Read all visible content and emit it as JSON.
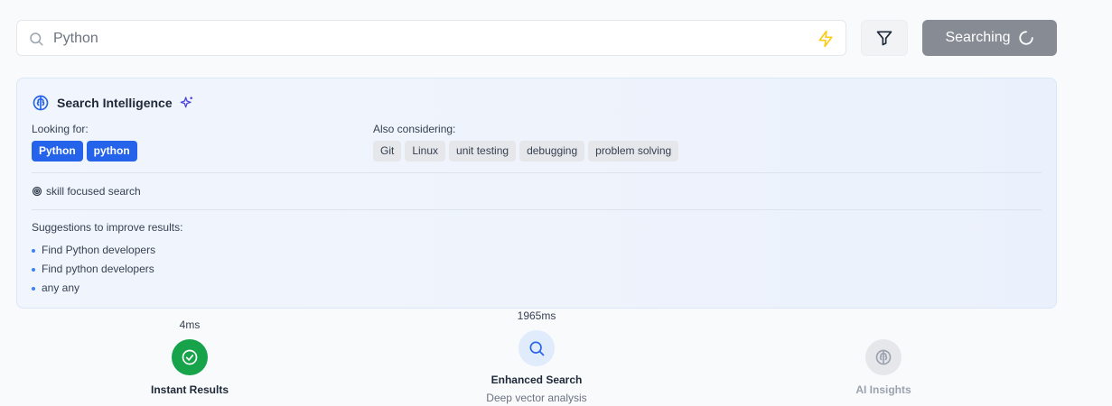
{
  "search": {
    "value": "Python",
    "placeholder": "Python",
    "button_label": "Searching"
  },
  "intelligence": {
    "title": "Search Intelligence",
    "looking_for_label": "Looking for:",
    "looking_for": [
      "Python",
      "python"
    ],
    "also_considering_label": "Also considering:",
    "also_considering": [
      "Git",
      "Linux",
      "unit testing",
      "debugging",
      "problem solving"
    ],
    "mode": "skill focused search",
    "suggestions_label": "Suggestions to improve results:",
    "suggestions": [
      "Find Python developers",
      "Find python developers",
      "any any"
    ]
  },
  "steps": [
    {
      "time": "4ms",
      "name": "Instant Results",
      "subtitle": "",
      "status": "complete",
      "icon": "check-circle-icon"
    },
    {
      "time": "1965ms",
      "name": "Enhanced Search",
      "subtitle": "Deep vector analysis",
      "status": "active",
      "icon": "search-icon"
    },
    {
      "time": "",
      "name": "AI Insights",
      "subtitle": "",
      "status": "pending",
      "icon": "brain-icon"
    }
  ],
  "colors": {
    "primary": "#2563eb",
    "success": "#16a34a",
    "warning": "#facc15",
    "muted_button": "#868b94",
    "sparkle": "#4f46e5"
  }
}
